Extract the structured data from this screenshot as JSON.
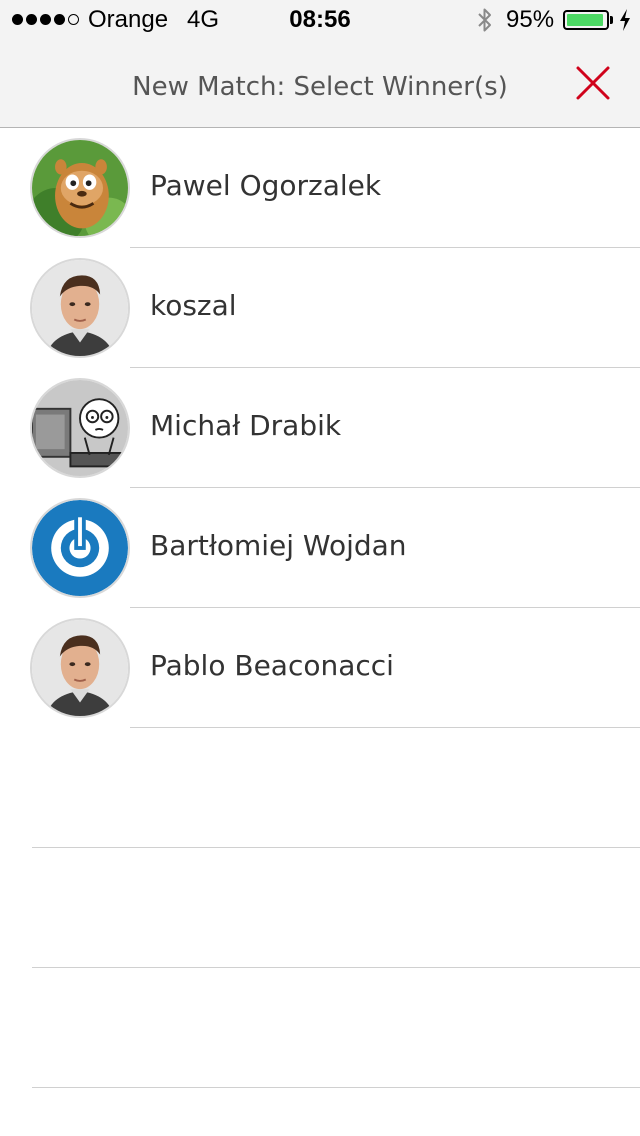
{
  "status_bar": {
    "carrier": "Orange",
    "network": "4G",
    "time": "08:56",
    "battery_percent": "95%",
    "battery_level": 0.95,
    "signal_bars_filled": 4,
    "signal_bars_total": 5
  },
  "nav": {
    "title": "New Match: Select Winner(s)",
    "close_icon": "close-x-icon",
    "accent_color": "#d0021b"
  },
  "players": [
    {
      "name": "Pawel Ogorzalek",
      "avatar": "cartoon-meerkat-avatar"
    },
    {
      "name": "koszal",
      "avatar": "man-photo-avatar"
    },
    {
      "name": "Michał Drabik",
      "avatar": "comic-computer-avatar"
    },
    {
      "name": "Bartłomiej Wojdan",
      "avatar": "power-logo-avatar"
    },
    {
      "name": "Pablo Beaconacci",
      "avatar": "man-photo-avatar"
    }
  ]
}
